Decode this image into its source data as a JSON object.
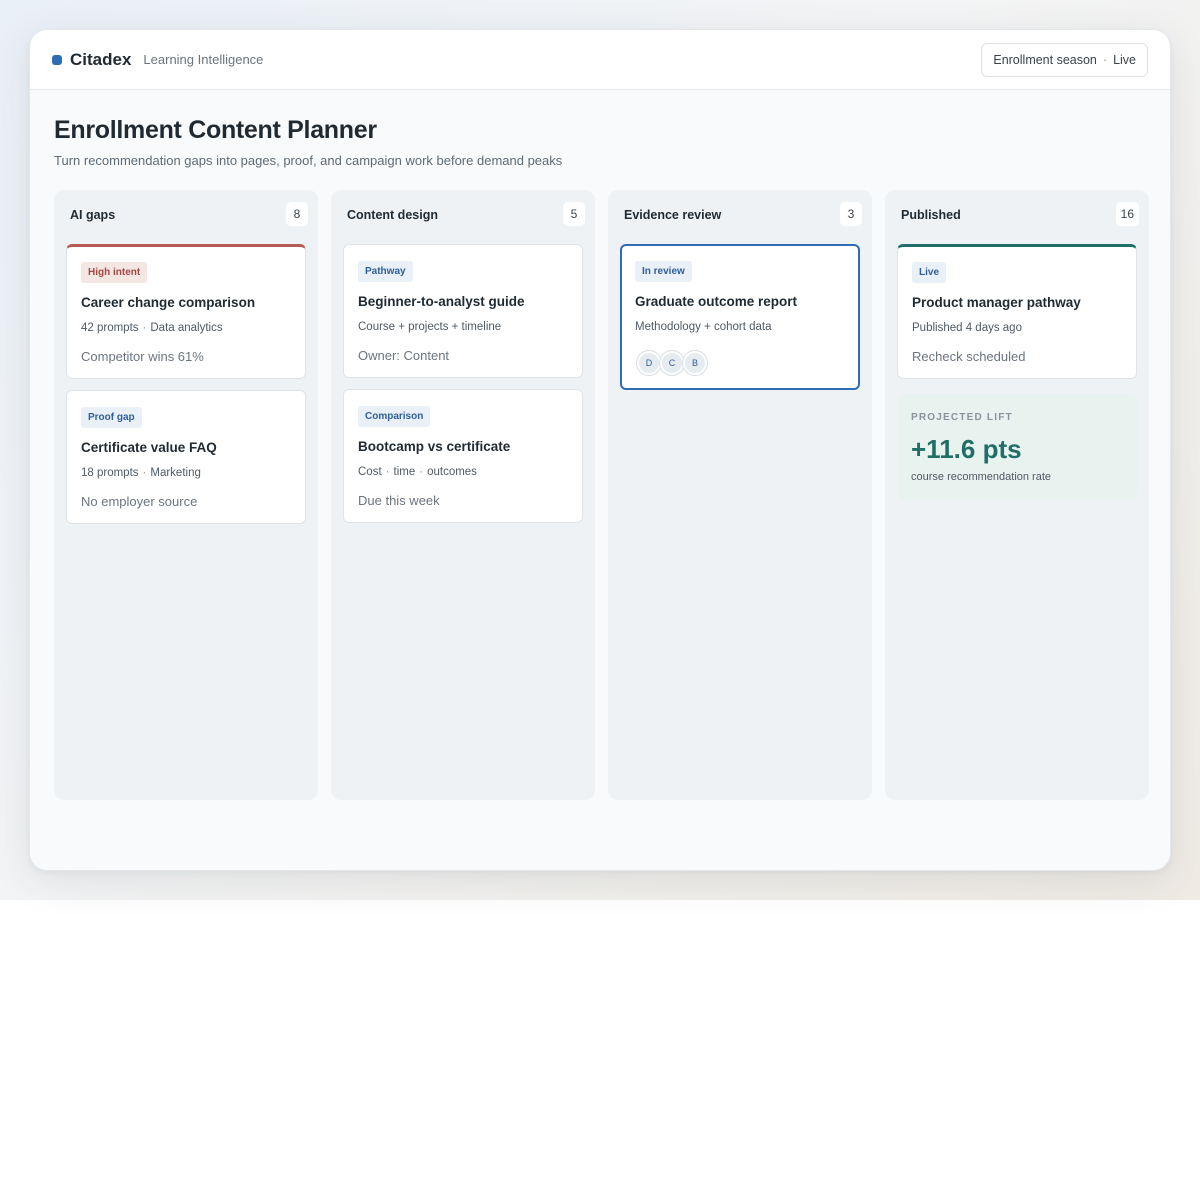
{
  "header": {
    "brand": "Citadex",
    "tagline": "Learning Intelligence",
    "season_label": "Enrollment season",
    "season_status": "Live"
  },
  "page": {
    "title": "Enrollment Content Planner",
    "subtitle": "Turn recommendation gaps into pages, proof, and campaign work before demand peaks"
  },
  "columns": [
    {
      "title": "AI gaps",
      "count": "8",
      "cards": [
        {
          "badge": "High intent",
          "title": "Career change comparison",
          "meta_a": "42 prompts",
          "meta_b": "Data analytics",
          "foot": "Competitor wins 61%"
        },
        {
          "badge": "Proof gap",
          "title": "Certificate value FAQ",
          "meta_a": "18 prompts",
          "meta_b": "Marketing",
          "foot": "No employer source"
        }
      ]
    },
    {
      "title": "Content design",
      "count": "5",
      "cards": [
        {
          "badge": "Pathway",
          "title": "Beginner-to-analyst guide",
          "meta": "Course + projects + timeline",
          "foot": "Owner: Content"
        },
        {
          "badge": "Comparison",
          "title": "Bootcamp vs certificate",
          "meta_a": "Cost",
          "meta_b": "time",
          "meta_c": "outcomes",
          "foot": "Due this week"
        }
      ]
    },
    {
      "title": "Evidence review",
      "count": "3",
      "cards": [
        {
          "badge": "In review",
          "title": "Graduate outcome report",
          "meta": "Methodology + cohort data",
          "avatars": [
            "D",
            "C",
            "B"
          ]
        }
      ]
    },
    {
      "title": "Published",
      "count": "16",
      "cards": [
        {
          "badge": "Live",
          "title": "Product manager pathway",
          "meta": "Published 4 days ago",
          "foot": "Recheck scheduled"
        }
      ],
      "lift": {
        "label": "PROJECTED LIFT",
        "value": "+11.6 pts",
        "desc": "course recommendation rate"
      }
    }
  ],
  "colors": {
    "accent": "#2f6db3",
    "high_intent": "#b85a54",
    "published": "#1f6f66"
  }
}
